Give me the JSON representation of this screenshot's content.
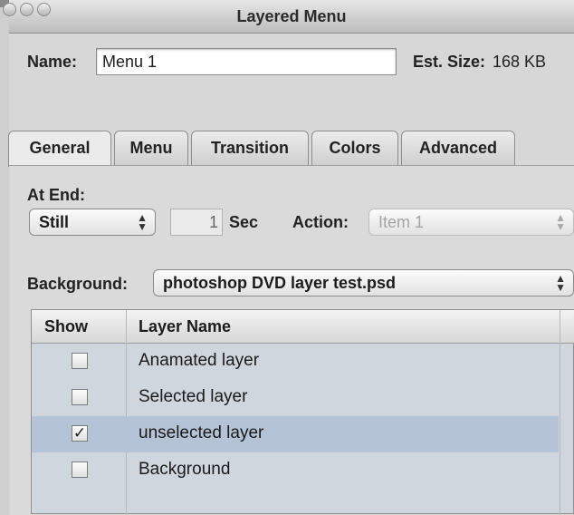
{
  "window": {
    "title": "Layered Menu"
  },
  "header": {
    "name_label": "Name:",
    "name_value": "Menu 1",
    "size_label": "Est. Size:",
    "size_value": "168 KB"
  },
  "tabs": [
    {
      "label": "General",
      "active": true
    },
    {
      "label": "Menu"
    },
    {
      "label": "Transition"
    },
    {
      "label": "Colors"
    },
    {
      "label": "Advanced"
    }
  ],
  "general": {
    "at_end_label": "At End:",
    "at_end_value": "Still",
    "duration_value": "1",
    "duration_unit": "Sec",
    "action_label": "Action:",
    "action_value": "Item 1",
    "background_label": "Background:",
    "background_value": "photoshop DVD layer test.psd"
  },
  "layers_table": {
    "columns": [
      "Show",
      "Layer Name"
    ],
    "rows": [
      {
        "show": false,
        "name": "Anamated layer"
      },
      {
        "show": false,
        "name": "Selected layer"
      },
      {
        "show": true,
        "name": "unselected layer",
        "selected": true
      },
      {
        "show": false,
        "name": "Background"
      }
    ]
  },
  "colors": {
    "selection_row": "#b4c3d6",
    "table_bg": "#d0d6de"
  }
}
